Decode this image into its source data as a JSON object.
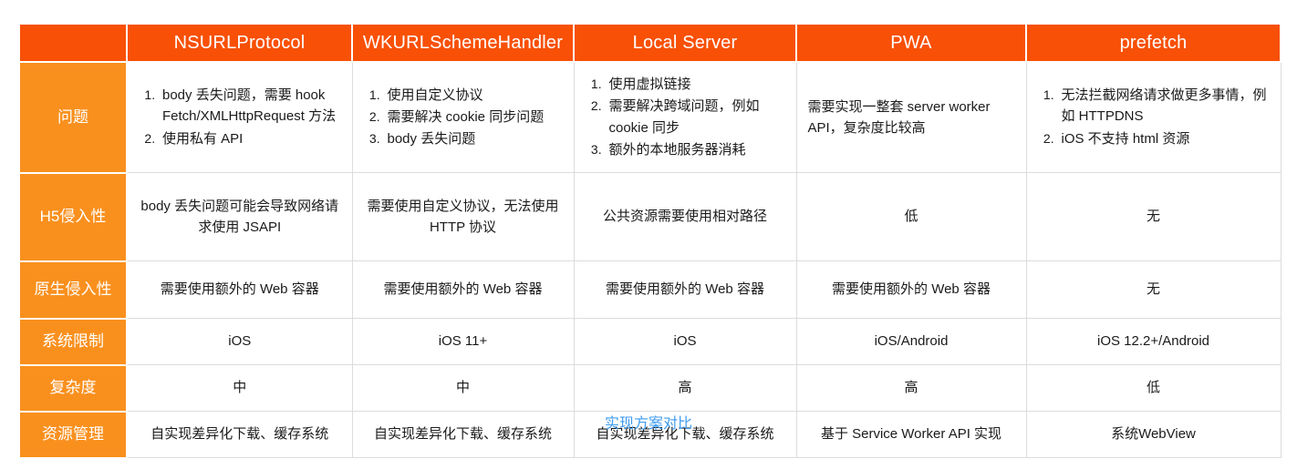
{
  "colors": {
    "header_bg": "#f85006",
    "rowlabel_bg": "#f9901e",
    "cell_bg": "#ffffff",
    "cell_text": "#1a1a1a",
    "grid_line": "#dcdcdc",
    "caption_text": "#3d9bf0",
    "page_bg": "#ffffff"
  },
  "table": {
    "corner_label": "",
    "columns": [
      {
        "key": "nsurlprotocol",
        "label": "NSURLProtocol"
      },
      {
        "key": "wkurlschemehandler",
        "label": "WKURLSchemeHandler"
      },
      {
        "key": "localserver",
        "label": "Local Server"
      },
      {
        "key": "pwa",
        "label": "PWA"
      },
      {
        "key": "prefetch",
        "label": "prefetch"
      }
    ],
    "rows": [
      {
        "key": "problems",
        "label": "问题",
        "cells": [
          {
            "type": "list",
            "align": "left",
            "items": [
              "body 丢失问题，需要 hook Fetch/XMLHttpRequest 方法",
              "使用私有 API"
            ]
          },
          {
            "type": "list",
            "align": "left",
            "items": [
              "使用自定义协议",
              "需要解决 cookie 同步问题",
              "body 丢失问题"
            ]
          },
          {
            "type": "list",
            "align": "left",
            "items": [
              "使用虚拟链接",
              "需要解决跨域问题，例如 cookie 同步",
              "额外的本地服务器消耗"
            ]
          },
          {
            "type": "text",
            "align": "left",
            "text": "需要实现一整套 server worker API，复杂度比较高"
          },
          {
            "type": "list",
            "align": "left",
            "items": [
              "无法拦截网络请求做更多事情，例如 HTTPDNS",
              "iOS 不支持 html 资源"
            ]
          }
        ]
      },
      {
        "key": "h5_intrusiveness",
        "label": "H5侵入性",
        "cells": [
          {
            "type": "text",
            "align": "center",
            "text": "body 丢失问题可能会导致网络请求使用 JSAPI"
          },
          {
            "type": "text",
            "align": "center",
            "text": "需要使用自定义协议，无法使用 HTTP 协议"
          },
          {
            "type": "text",
            "align": "center",
            "text": "公共资源需要使用相对路径"
          },
          {
            "type": "text",
            "align": "center",
            "text": "低"
          },
          {
            "type": "text",
            "align": "center",
            "text": "无"
          }
        ]
      },
      {
        "key": "native_intrusiveness",
        "label": "原生侵入性",
        "cells": [
          {
            "type": "text",
            "align": "center",
            "text": "需要使用额外的 Web 容器"
          },
          {
            "type": "text",
            "align": "center",
            "text": "需要使用额外的 Web 容器"
          },
          {
            "type": "text",
            "align": "center",
            "text": "需要使用额外的 Web 容器"
          },
          {
            "type": "text",
            "align": "center",
            "text": "需要使用额外的 Web 容器"
          },
          {
            "type": "text",
            "align": "center",
            "text": "无"
          }
        ]
      },
      {
        "key": "os_limits",
        "label": "系统限制",
        "cells": [
          {
            "type": "text",
            "align": "center",
            "text": "iOS"
          },
          {
            "type": "text",
            "align": "center",
            "text": "iOS 11+"
          },
          {
            "type": "text",
            "align": "center",
            "text": "iOS"
          },
          {
            "type": "text",
            "align": "center",
            "text": "iOS/Android"
          },
          {
            "type": "text",
            "align": "center",
            "text": "iOS 12.2+/Android"
          }
        ]
      },
      {
        "key": "complexity",
        "label": "复杂度",
        "cells": [
          {
            "type": "text",
            "align": "center",
            "text": "中"
          },
          {
            "type": "text",
            "align": "center",
            "text": "中"
          },
          {
            "type": "text",
            "align": "center",
            "text": "高"
          },
          {
            "type": "text",
            "align": "center",
            "text": "高"
          },
          {
            "type": "text",
            "align": "center",
            "text": "低"
          }
        ]
      },
      {
        "key": "resource_management",
        "label": "资源管理",
        "cells": [
          {
            "type": "text",
            "align": "center",
            "text": "自实现差异化下载、缓存系统"
          },
          {
            "type": "text",
            "align": "center",
            "text": "自实现差异化下载、缓存系统"
          },
          {
            "type": "text",
            "align": "center",
            "text": "自实现差异化下载、缓存系统"
          },
          {
            "type": "text",
            "align": "center",
            "text": "基于 Service Worker API 实现"
          },
          {
            "type": "text",
            "align": "center",
            "text": "系统WebView"
          }
        ]
      }
    ]
  },
  "caption": {
    "text": "实现方案对比"
  }
}
